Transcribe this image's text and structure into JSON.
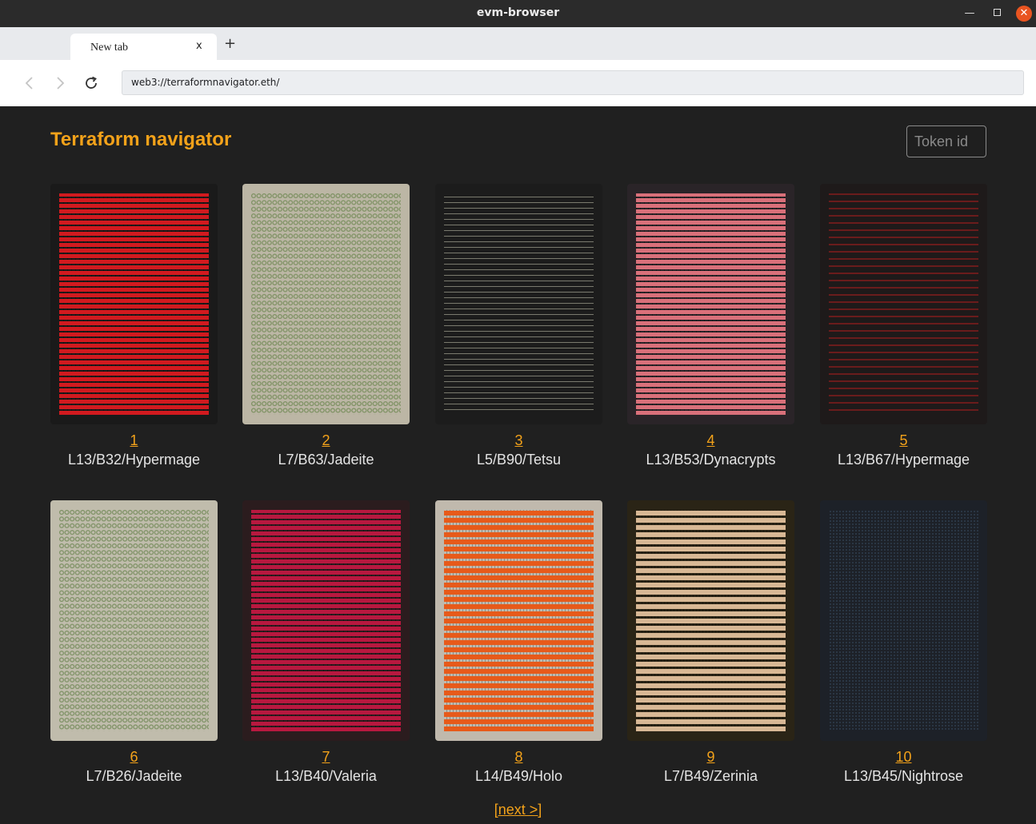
{
  "window": {
    "title": "evm-browser",
    "minimize_icon": "minimize-icon",
    "maximize_icon": "maximize-icon",
    "close_icon": "close-icon"
  },
  "tabs": [
    {
      "label": "New tab",
      "close_glyph": "x"
    }
  ],
  "new_tab_glyph": "+",
  "toolbar": {
    "back_glyph": "‹",
    "forward_glyph": "›",
    "reload_glyph": "↻",
    "url": "web3://terraformnavigator.eth/"
  },
  "page": {
    "title": "Terraform navigator",
    "token_placeholder": "Token id",
    "cards": [
      {
        "id": "1",
        "label": "L13/B32/Hypermage",
        "bg": "#1a1a1a",
        "fg": "#d11a1f",
        "style": "dense"
      },
      {
        "id": "2",
        "label": "L7/B63/Jadeite",
        "bg": "#bcb6a5",
        "fg": "#7f9264",
        "style": "rings"
      },
      {
        "id": "3",
        "label": "L5/B90/Tetsu",
        "bg": "#1c1c1c",
        "fg": "#7a7a6e",
        "style": "dashes"
      },
      {
        "id": "4",
        "label": "L13/B53/Dynacrypts",
        "bg": "#2a2428",
        "fg": "#d9707a",
        "style": "dense"
      },
      {
        "id": "5",
        "label": "L13/B67/Hypermage",
        "bg": "#1e1a1a",
        "fg": "#6a1c1c",
        "style": "waves"
      },
      {
        "id": "6",
        "label": "L7/B26/Jadeite",
        "bg": "#c0bcac",
        "fg": "#7f9266",
        "style": "rings"
      },
      {
        "id": "7",
        "label": "L13/B40/Valeria",
        "bg": "#2b1c1e",
        "fg": "#b8183f",
        "style": "dense"
      },
      {
        "id": "8",
        "label": "L14/B49/Holo",
        "bg": "#c0b9ad",
        "fg": "#e75a1a",
        "style": "bands"
      },
      {
        "id": "9",
        "label": "L7/B49/Zerinia",
        "bg": "#2a2416",
        "fg": "#d8b895",
        "style": "bands"
      },
      {
        "id": "10",
        "label": "L13/B45/Nightrose",
        "bg": "#1d2128",
        "fg": "#2c3a4a",
        "style": "dots"
      }
    ],
    "next_label": "[next >]"
  }
}
